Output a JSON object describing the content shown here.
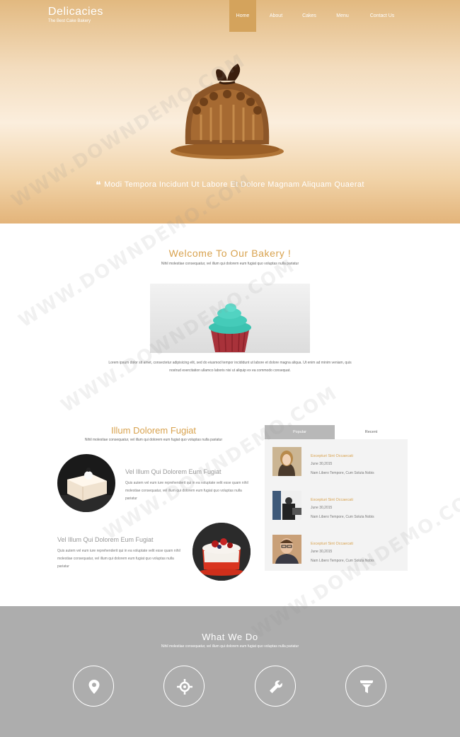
{
  "brand": {
    "title": "Delicacies",
    "subtitle": "The Best Cake Bakery"
  },
  "nav": [
    {
      "label": "Home",
      "active": true
    },
    {
      "label": "About",
      "active": false
    },
    {
      "label": "Cakes",
      "active": false
    },
    {
      "label": "Menu",
      "active": false
    },
    {
      "label": "Contact Us",
      "active": false
    }
  ],
  "hero": {
    "quote": "Modi Tempora Incidunt Ut Labore Et Dolore Magnam Aliquam Quaerat"
  },
  "welcome": {
    "title": "Welcome To Our Bakery !",
    "subtitle": "Nihil molestiae consequatur, vel illum qui dolorem eum fugiat quo voluptas nulla pariatur",
    "body": "Lorem ipsum dolor sit amet, consectetur adipisicing elit, sed do eiusmod tempor incididunt ut labore et dolore magna aliqua. Ut enim ad minim veniam, quis nostrud exercitation ullamco laboris nisi ut aliquip ex ea commodo consequat."
  },
  "middle": {
    "title": "Illum Dolorem Fugiat",
    "subtitle": "Nihil molestiae consequatur, vel illum qui dolorem eum fugiat quo voluptas nulla pariatur",
    "features": [
      {
        "title": "Vel Illum Qui Dolorem Eum Fugiat",
        "text": "Quis autem vel eum iure reprehenderit qui in ea voluptate velit esse quam nihil molestiae consequatur, vel illum qui dolorem eum fugiat quo voluptas nulla pariatur"
      },
      {
        "title": "Vel Illum Qui Dolorem Eum Fugiat",
        "text": "Quis autem vel eum iure reprehenderit qui in ea voluptate velit esse quam nihil molestiae consequatur, vel illum qui dolorem eum fugiat quo voluptas nulla pariatur"
      }
    ]
  },
  "tabs": {
    "labels": [
      "Popular",
      "Recent"
    ],
    "posts": [
      {
        "title": "Excepturi Sint Occaecati",
        "date": "June 30,2015",
        "text": "Nam Libero Tempore, Cum Soluta Nobis"
      },
      {
        "title": "Excepturi Sint Occaecati",
        "date": "June 30,2015",
        "text": "Nam Libero Tempore, Cum Soluta Nobis"
      },
      {
        "title": "Excepturi Sint Occaecati",
        "date": "June 30,2015",
        "text": "Nam Libero Tempore, Cum Soluta Nobis"
      }
    ]
  },
  "what": {
    "title": "What We Do",
    "subtitle": "Nihil molestiae consequatur, vel illum qui dolorem eum fugiat quo voluptas nulla pariatur",
    "services": [
      "map-marker-icon",
      "crosshair-icon",
      "wrench-icon",
      "filter-icon"
    ]
  },
  "watermark": "WWW.DOWNDEMO.COM",
  "colors": {
    "accent": "#d8a24e",
    "nav_active": "#d4a35c",
    "section_gray": "#adadad"
  }
}
